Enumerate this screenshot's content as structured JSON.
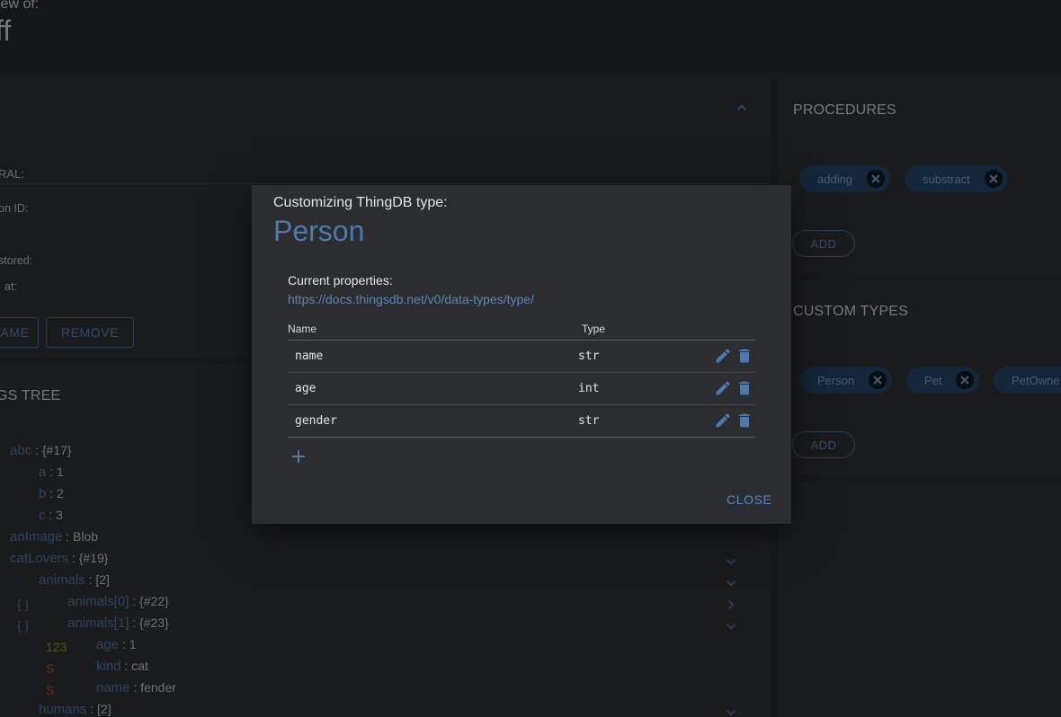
{
  "page": {
    "pre_title": "iew of:",
    "title": "ff"
  },
  "general": {
    "section_label": "RAL:",
    "fields": [
      "on ID:",
      "stored:",
      "at:"
    ],
    "rename_label": "AME",
    "remove_label": "REMOVE"
  },
  "procedures": {
    "title": "PROCEDURES",
    "chips": [
      "adding",
      "substract"
    ],
    "add_label": "ADD"
  },
  "custom_types": {
    "title": "CUSTOM TYPES",
    "chips": [
      "Person",
      "Pet",
      "PetOwne"
    ],
    "add_label": "ADD"
  },
  "things_tree": {
    "title": "GS TREE",
    "rows": [
      {
        "key": "abc",
        "value": "{#17}",
        "icon": ""
      },
      {
        "key": "a",
        "value": "1",
        "icon": ""
      },
      {
        "key": "b",
        "value": "2",
        "icon": ""
      },
      {
        "key": "c",
        "value": "3",
        "icon": ""
      },
      {
        "key": "anImage",
        "value": "Blob",
        "icon": ""
      },
      {
        "key": "catLovers",
        "value": "{#19}",
        "icon": ""
      },
      {
        "key": "animals",
        "value": "[2]",
        "icon": ""
      },
      {
        "key": "animals[0]",
        "value": "{#22}",
        "icon": "{ }"
      },
      {
        "key": "animals[1]",
        "value": "{#23}",
        "icon": "{ }"
      },
      {
        "key": "age",
        "value": "1",
        "icon": "123"
      },
      {
        "key": "kind",
        "value": "cat",
        "icon": "S"
      },
      {
        "key": "name",
        "value": "fender",
        "icon": "S"
      },
      {
        "key": "humans",
        "value": "[2]",
        "icon": ""
      }
    ]
  },
  "modal": {
    "subtitle": "Customizing ThingDB type:",
    "title": "Person",
    "current_properties_label": "Current properties:",
    "docs_link": "https://docs.thingsdb.net/v0/data-types/type/",
    "columns": {
      "name": "Name",
      "type": "Type"
    },
    "properties": [
      {
        "name": "name",
        "type": "str"
      },
      {
        "name": "age",
        "type": "int"
      },
      {
        "name": "gender",
        "type": "str"
      }
    ],
    "close_label": "CLOSE"
  },
  "colors": {
    "accent": "#4f79ae",
    "chip_bg": "#23456a",
    "int_icon": "#a38a2c",
    "str_icon": "#b4532a"
  }
}
